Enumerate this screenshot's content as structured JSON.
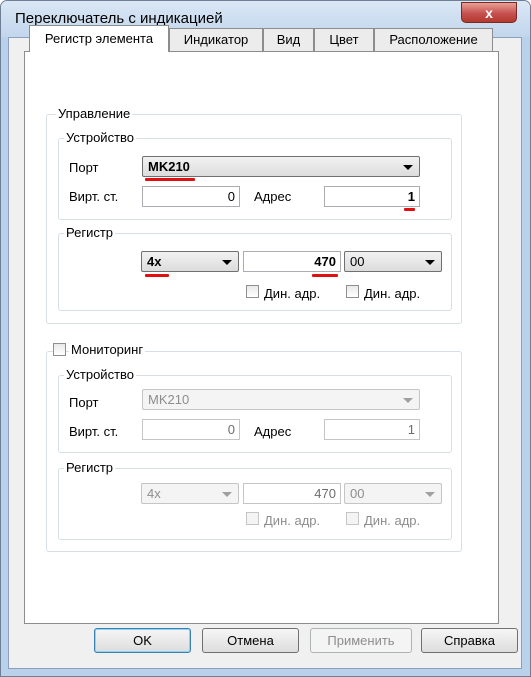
{
  "window": {
    "title": "Переключатель с индикацией",
    "close_label": "x"
  },
  "tabs": [
    {
      "label": "Регистр элемента",
      "active": true
    },
    {
      "label": "Индикатор"
    },
    {
      "label": "Вид"
    },
    {
      "label": "Цвет"
    },
    {
      "label": "Расположение"
    }
  ],
  "control": {
    "legend": "Управление",
    "device": {
      "legend": "Устройство",
      "port_label": "Порт",
      "port_value": "MK210",
      "virt_label": "Вирт. ст.",
      "virt_value": "0",
      "addr_label": "Адрес",
      "addr_value": "1"
    },
    "register": {
      "legend": "Регистр",
      "type_value": "4x",
      "number_value": "470",
      "sub_value": "00",
      "dyn_label_1": "Дин. адр.",
      "dyn_label_2": "Дин. адр."
    }
  },
  "monitoring": {
    "legend": "Мониторинг",
    "device": {
      "legend": "Устройство",
      "port_label": "Порт",
      "port_value": "MK210",
      "virt_label": "Вирт. ст.",
      "virt_value": "0",
      "addr_label": "Адрес",
      "addr_value": "1"
    },
    "register": {
      "legend": "Регистр",
      "type_value": "4x",
      "number_value": "470",
      "sub_value": "00",
      "dyn_label_1": "Дин. адр.",
      "dyn_label_2": "Дин. адр."
    }
  },
  "buttons": {
    "ok": "OK",
    "cancel": "Отмена",
    "apply": "Применить",
    "help": "Справка"
  },
  "colors": {
    "annotation": "#e01010",
    "accent": "#3c7fb1"
  }
}
